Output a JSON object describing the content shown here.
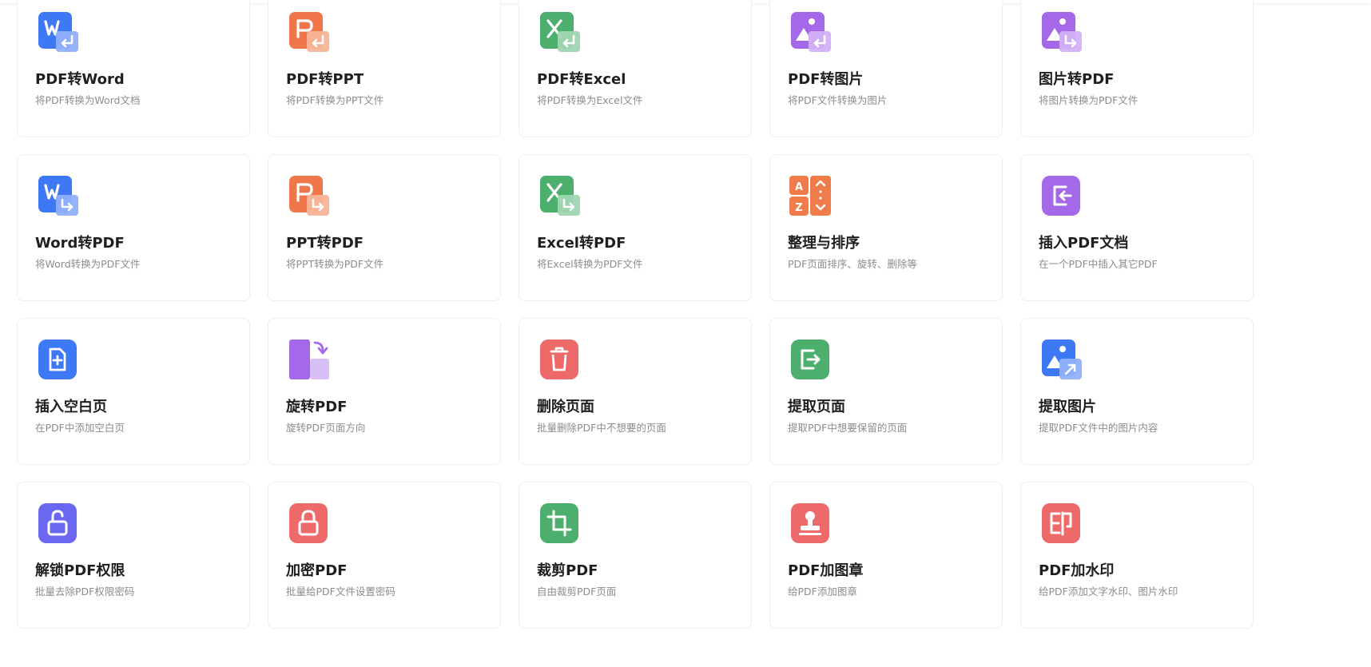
{
  "colors": {
    "word_blue": "#3d78f5",
    "ppt_orange": "#f0774a",
    "excel_green": "#4caf6e",
    "image_purple": "#a568e8",
    "sort_orange": "#ef7c4a",
    "delete_red": "#ee6a6a",
    "unlock_indigo": "#6a68f0",
    "title_text": "#1f1f1f",
    "desc_text": "#8c8c8c",
    "card_border": "#eceef2"
  },
  "tools": [
    {
      "title": "PDF转Word",
      "desc": "将PDF转换为Word文档",
      "icon": "pdf-to-word-icon"
    },
    {
      "title": "PDF转PPT",
      "desc": "将PDF转换为PPT文件",
      "icon": "pdf-to-ppt-icon"
    },
    {
      "title": "PDF转Excel",
      "desc": "将PDF转换为Excel文件",
      "icon": "pdf-to-excel-icon"
    },
    {
      "title": "PDF转图片",
      "desc": "将PDF文件转换为图片",
      "icon": "pdf-to-image-icon"
    },
    {
      "title": "图片转PDF",
      "desc": "将图片转换为PDF文件",
      "icon": "image-to-pdf-icon"
    },
    {
      "title": "Word转PDF",
      "desc": "将Word转换为PDF文件",
      "icon": "word-to-pdf-icon"
    },
    {
      "title": "PPT转PDF",
      "desc": "将PPT转换为PDF文件",
      "icon": "ppt-to-pdf-icon"
    },
    {
      "title": "Excel转PDF",
      "desc": "将Excel转换为PDF文件",
      "icon": "excel-to-pdf-icon"
    },
    {
      "title": "整理与排序",
      "desc": "PDF页面排序、旋转、删除等",
      "icon": "sort-az-icon"
    },
    {
      "title": "插入PDF文档",
      "desc": "在一个PDF中插入其它PDF",
      "icon": "insert-document-icon"
    },
    {
      "title": "插入空白页",
      "desc": "在PDF中添加空白页",
      "icon": "insert-blank-page-icon"
    },
    {
      "title": "旋转PDF",
      "desc": "旋转PDF页面方向",
      "icon": "rotate-page-icon"
    },
    {
      "title": "删除页面",
      "desc": "批量删除PDF中不想要的页面",
      "icon": "trash-icon"
    },
    {
      "title": "提取页面",
      "desc": "提取PDF中想要保留的页面",
      "icon": "extract-page-icon"
    },
    {
      "title": "提取图片",
      "desc": "提取PDF文件中的图片内容",
      "icon": "extract-image-icon"
    },
    {
      "title": "解锁PDF权限",
      "desc": "批量去除PDF权限密码",
      "icon": "unlock-icon"
    },
    {
      "title": "加密PDF",
      "desc": "批量给PDF文件设置密码",
      "icon": "lock-icon"
    },
    {
      "title": "裁剪PDF",
      "desc": "自由裁剪PDF页面",
      "icon": "crop-icon"
    },
    {
      "title": "PDF加图章",
      "desc": "给PDF添加图章",
      "icon": "stamp-icon"
    },
    {
      "title": "PDF加水印",
      "desc": "给PDF添加文字水印、图片水印",
      "icon": "watermark-icon"
    }
  ]
}
